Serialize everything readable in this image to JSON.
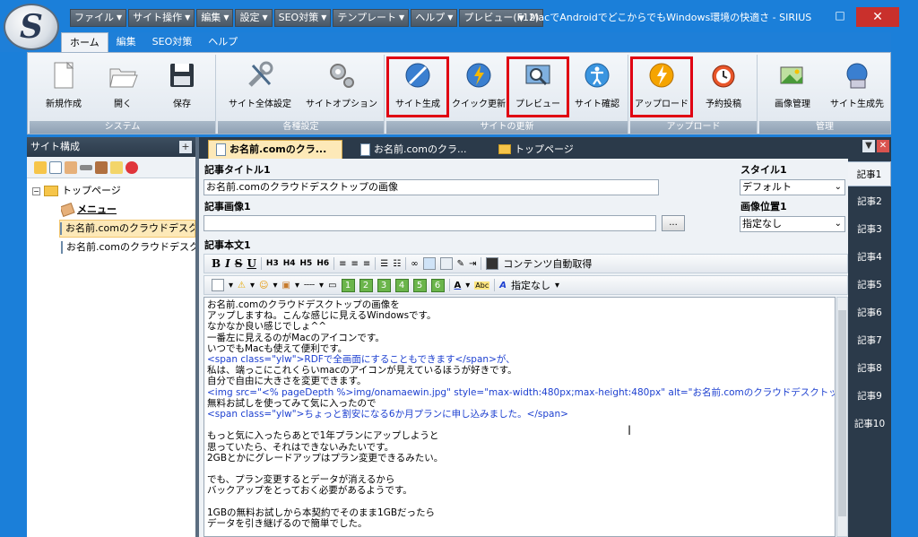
{
  "window": {
    "title": "MacでAndroidでどこからでもWindows環境の快適さ - SIRIUS",
    "restore_glyph": "□",
    "close_glyph": "✕"
  },
  "menubar": [
    "ファイル",
    "サイト操作",
    "編集",
    "設定",
    "SEO対策",
    "テンプレート",
    "ヘルプ",
    "プレビュー(F12)"
  ],
  "ribbon_tabs": [
    "ホーム",
    "編集",
    "SEO対策",
    "ヘルプ"
  ],
  "ribbon": {
    "groups": [
      {
        "label": "システム",
        "buttons": [
          "新規作成",
          "開く",
          "保存"
        ]
      },
      {
        "label": "各種設定",
        "buttons": [
          "サイト全体設定",
          "サイトオプション"
        ]
      },
      {
        "label": "サイトの更新",
        "buttons": [
          "サイト生成",
          "クイック更新",
          "プレビュー",
          "サイト確認"
        ]
      },
      {
        "label": "アップロード",
        "buttons": [
          "アップロード",
          "予約投稿"
        ]
      },
      {
        "label": "管理",
        "buttons": [
          "画像管理",
          "サイト生成先"
        ]
      }
    ]
  },
  "left_panel": {
    "title": "サイト構成",
    "plus": "+",
    "tree": {
      "toggle": "−",
      "root": "トップページ",
      "items": [
        "メニュー",
        "お名前.comのクラウドデスク",
        "お名前.comのクラウドデスク"
      ]
    }
  },
  "doc_tabs": [
    "お名前.comのクラ...",
    "お名前.comのクラ...",
    "トップページ"
  ],
  "editor": {
    "title_label": "記事タイトル1",
    "title_value": "お名前.comのクラウドデスクトップの画像",
    "image_label": "記事画像1",
    "image_value": "",
    "browse": "...",
    "style_label": "スタイル1",
    "style_value": "デフォルト",
    "image_pos_label": "画像位置1",
    "image_pos_value": "指定なし",
    "body_label": "記事本文1",
    "toolbar1": {
      "bold": "B",
      "italic": "I",
      "strike": "S",
      "underline": "U",
      "headings": [
        "H3",
        "H4",
        "H5",
        "H6"
      ],
      "auto_content": "コンテンツ自動取得"
    },
    "toolbar2": {
      "numbers": [
        "1",
        "2",
        "3",
        "4",
        "5",
        "6"
      ],
      "font_sample": "Abc",
      "font_setting": "指定なし"
    },
    "body_lines": [
      "お名前.comのクラウドデスクトップの画像を",
      "アップしますね。こんな感じに見えるWindowsです。",
      "なかなか良い感じでしょ^^",
      "一番左に見えるのがMacのアイコンです。",
      "いつでもMacも使えて便利です。",
      "<span class=\"ylw\">RDFで全画面にすることもできます</span>が、",
      "私は、端っこにこれくらいmacのアイコンが見えているほうが好きです。",
      "自分で自由に大きさを変更できます。",
      "<img src=\"<% pageDepth %>img/onamaewin.jpg\" style=\"max-width:480px;max-height:480px\" alt=\"お名前.comのクラウドデスクトップ画像\" />",
      "無料お試しを使ってみて気に入ったので",
      "<span class=\"ylw\">ちょっと割安になる6か月プランに申し込みました。</span>",
      "",
      "もっと気に入ったらあとで1年プランにアップしようと",
      "思っていたら、それはできないみたいです。",
      "2GBとかにグレードアップはプラン変更できるみたい。",
      "",
      "でも、プラン変更するとデータが消えるから",
      "バックアップをとっておく必要があるようです。",
      "",
      "1GBの無料お試しから本契約でそのまま1GBだったら",
      "データを引き継げるので簡単でした。"
    ]
  },
  "side_tabs": [
    "記事1",
    "記事2",
    "記事3",
    "記事4",
    "記事5",
    "記事6",
    "記事7",
    "記事8",
    "記事9",
    "記事10"
  ],
  "icons": {
    "logo": "sirius-logo-icon",
    "cursor_glyph": "I"
  },
  "colors": {
    "titlebar": "#1b7fd9",
    "close": "#c9302c",
    "highlight": "#e00012",
    "selected_tab": "#fde9b8",
    "dark_panel": "#2b3a4a"
  }
}
